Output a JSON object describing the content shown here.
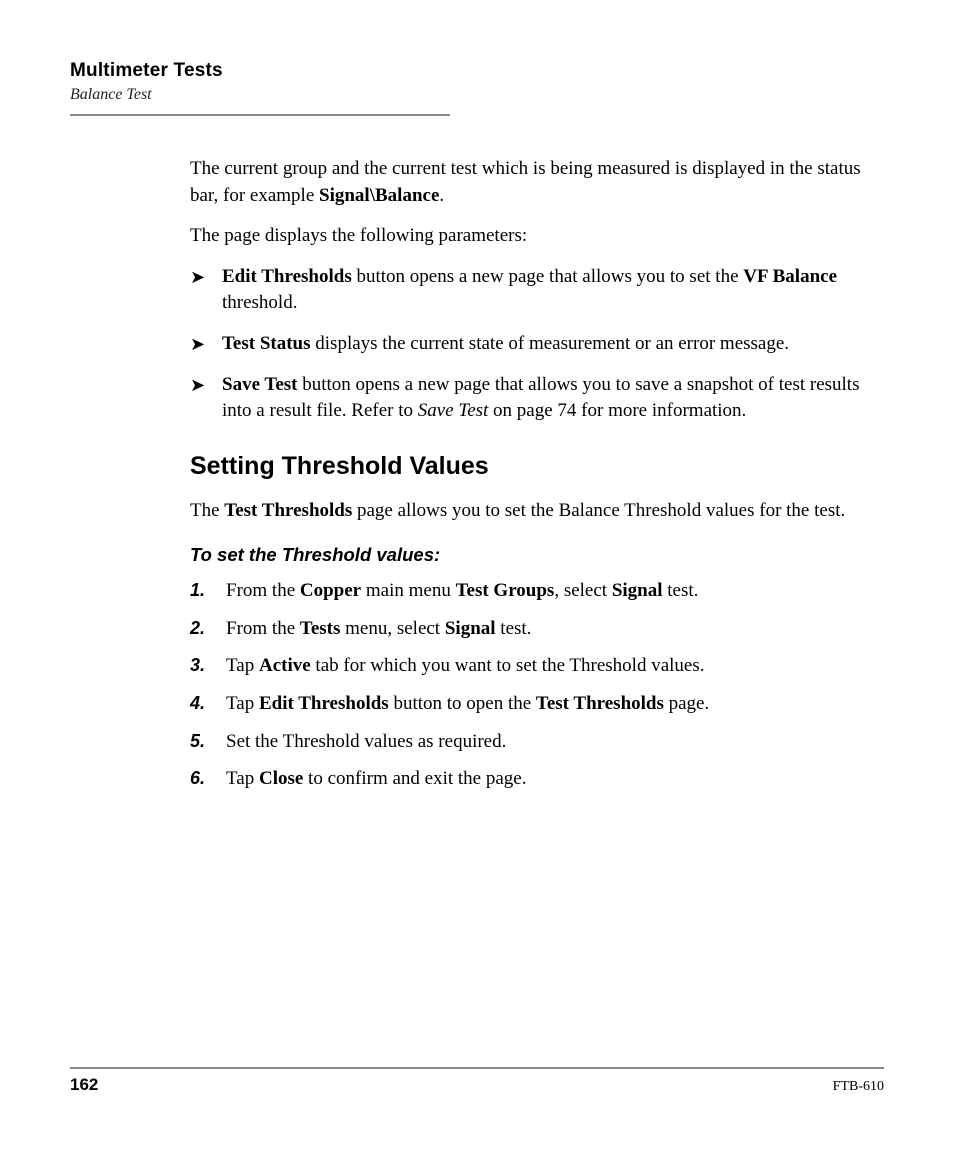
{
  "header": {
    "chapter": "Multimeter Tests",
    "subsection": "Balance Test"
  },
  "intro": {
    "p1_a": "The current group and the current test which is being measured is displayed in the status bar, for example ",
    "p1_b": "Signal\\Balance",
    "p1_c": ".",
    "p2": "The page displays the following parameters:"
  },
  "bullets": [
    {
      "lead": "Edit Thresholds",
      "mid": " button opens a new page that allows you to set the ",
      "bold2": "VF Balance",
      "tail": " threshold."
    },
    {
      "lead": "Test Status",
      "mid": " displays the current state of measurement or an error message.",
      "bold2": "",
      "tail": ""
    },
    {
      "lead": "Save Test",
      "mid": " button opens a new page that allows you to save a snapshot of test results into a result file. Refer to ",
      "ital": "Save Test",
      "tail": " on page 74 for more information."
    }
  ],
  "section": {
    "heading": "Setting Threshold Values",
    "desc_a": "The ",
    "desc_b": "Test Thresholds",
    "desc_c": " page allows you to set the Balance Threshold values for the test.",
    "task": "To set the Threshold values:"
  },
  "steps": [
    {
      "n": "1.",
      "a": "From the ",
      "b1": "Copper",
      "c": " main menu ",
      "b2": "Test Groups",
      "d": ", select ",
      "b3": "Signal",
      "e": " test."
    },
    {
      "n": "2.",
      "a": "From the ",
      "b1": "Tests",
      "c": " menu, select ",
      "b2": "Signal",
      "d": " test.",
      "b3": "",
      "e": ""
    },
    {
      "n": "3.",
      "a": "Tap ",
      "b1": "Active",
      "c": " tab for which you want to set the Threshold values.",
      "b2": "",
      "d": "",
      "b3": "",
      "e": ""
    },
    {
      "n": "4.",
      "a": "Tap ",
      "b1": "Edit Thresholds",
      "c": " button to open the ",
      "b2": "Test Thresholds",
      "d": " page.",
      "b3": "",
      "e": ""
    },
    {
      "n": "5.",
      "a": "Set the Threshold values as required.",
      "b1": "",
      "c": "",
      "b2": "",
      "d": "",
      "b3": "",
      "e": ""
    },
    {
      "n": "6.",
      "a": "Tap ",
      "b1": "Close",
      "c": " to confirm and exit the page.",
      "b2": "",
      "d": "",
      "b3": "",
      "e": ""
    }
  ],
  "footer": {
    "page": "162",
    "docid": "FTB-610"
  }
}
